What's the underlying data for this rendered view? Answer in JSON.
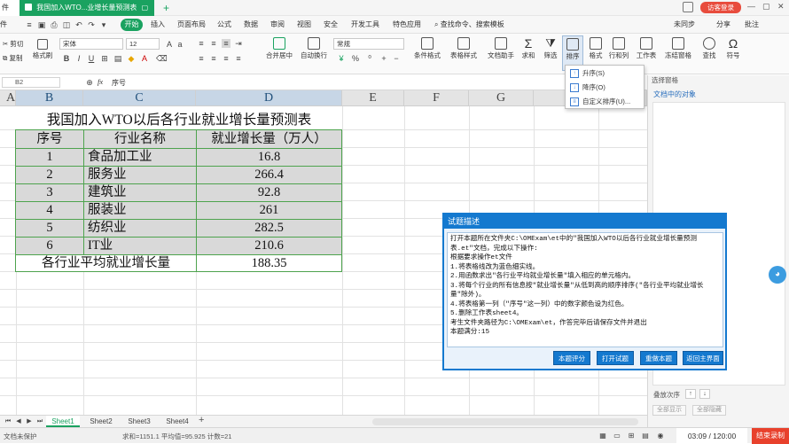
{
  "titlebar": {
    "left_label": "件",
    "doc_tab": "我国加入WTO...业增长量预测表",
    "doc_tab_marker": "▢",
    "add_tab": "+",
    "login_label": "访客登录",
    "win_controls": [
      "—",
      "▢",
      "✕"
    ]
  },
  "menubar": {
    "start_label": "开始",
    "items": [
      "插入",
      "页面布局",
      "公式",
      "数据",
      "审阅",
      "视图",
      "安全",
      "开发工具",
      "特色应用"
    ],
    "search_label": "查找命令、搜索模板",
    "right_items": [
      "未同步",
      "分享",
      "批注"
    ],
    "file_label": "件"
  },
  "ribbon": {
    "cut": "剪切",
    "copy": "复制",
    "format_painter": "格式刷",
    "font_name": "宋体",
    "font_size": "12",
    "bold": "B",
    "italic": "I",
    "underline": "U",
    "merge_center": "合并居中",
    "wrap": "自动换行",
    "number_format": "常规",
    "cond_format": "条件格式",
    "table_style": "表格样式",
    "doc_helper": "文档助手",
    "sum": "求和",
    "filter": "筛选",
    "sort": "排序",
    "format": "格式",
    "rowcol": "行和列",
    "sheet": "工作表",
    "freeze": "冻结窗格",
    "find": "查找",
    "symbol": "符号"
  },
  "formulabar": {
    "cell_ref": "B2",
    "fx": "fx",
    "content": "序号"
  },
  "columns": [
    "A",
    "B",
    "C",
    "D",
    "E",
    "F",
    "G",
    "H"
  ],
  "sheet": {
    "title": "我国加入WTO以后各行业就业增长量预测表",
    "headers": [
      "序号",
      "行业名称",
      "就业增长量（万人）"
    ],
    "rows": [
      {
        "no": "1",
        "name": "食品加工业",
        "value": "16.8"
      },
      {
        "no": "2",
        "name": "服务业",
        "value": "266.4"
      },
      {
        "no": "3",
        "name": "建筑业",
        "value": "92.8"
      },
      {
        "no": "4",
        "name": "服装业",
        "value": "261"
      },
      {
        "no": "5",
        "name": "纺织业",
        "value": "282.5"
      },
      {
        "no": "6",
        "name": "IT业",
        "value": "210.6"
      }
    ],
    "avg_label": "各行业平均就业增长量",
    "avg_value": "188.35"
  },
  "sort_menu": {
    "items": [
      "升序(S)",
      "降序(O)",
      "自定义排序(U)..."
    ]
  },
  "right_panel": {
    "title": "选择窗格",
    "subtitle": "文档中的对象",
    "order_label": "叠放次序",
    "show_all": "全部显示",
    "hide_all": "全部隐藏"
  },
  "dialog": {
    "title": "试题描述",
    "lines": [
      "打开本题所在文件夹C:\\OMExam\\et中的\"我国加入WTO以后各行业就业增长量预测表.et\"文档，完成以下操作:",
      "根据要求操作et文件",
      "1.将表格线改为蓝色细实线。",
      "2.用函数求出\"各行业平均就业增长量\"填入相应的单元格内。",
      "3.将每个行业的所有信息按\"就业增长量\"从低到高的顺序排序(\"各行业平均就业增长量\"除外)。",
      "4.将表格第一列（\"序号\"这一列）中的数字颜色设为红色。",
      "5.删除工作表sheet4。",
      "考生文件夹路径为C:\\OMExam\\et，作答完毕后请保存文件并退出",
      "本题满分:15"
    ],
    "buttons": [
      "本题评分",
      "打开试题",
      "重做本题",
      "返回主界面"
    ]
  },
  "sheet_tabs": [
    "Sheet1",
    "Sheet2",
    "Sheet3",
    "Sheet4"
  ],
  "status": {
    "protect": "文档未保护",
    "stats": "求和=1151.1  平均值=95.925  计数=21",
    "timer": "03:09 / 120:00",
    "end_button": "结束录制"
  },
  "colors": {
    "accent_green": "#1aa260",
    "dialog_blue": "#1479cf",
    "table_border": "#4ea34e",
    "header_fill": "#d9d9d9",
    "end_button": "#e8412c"
  }
}
